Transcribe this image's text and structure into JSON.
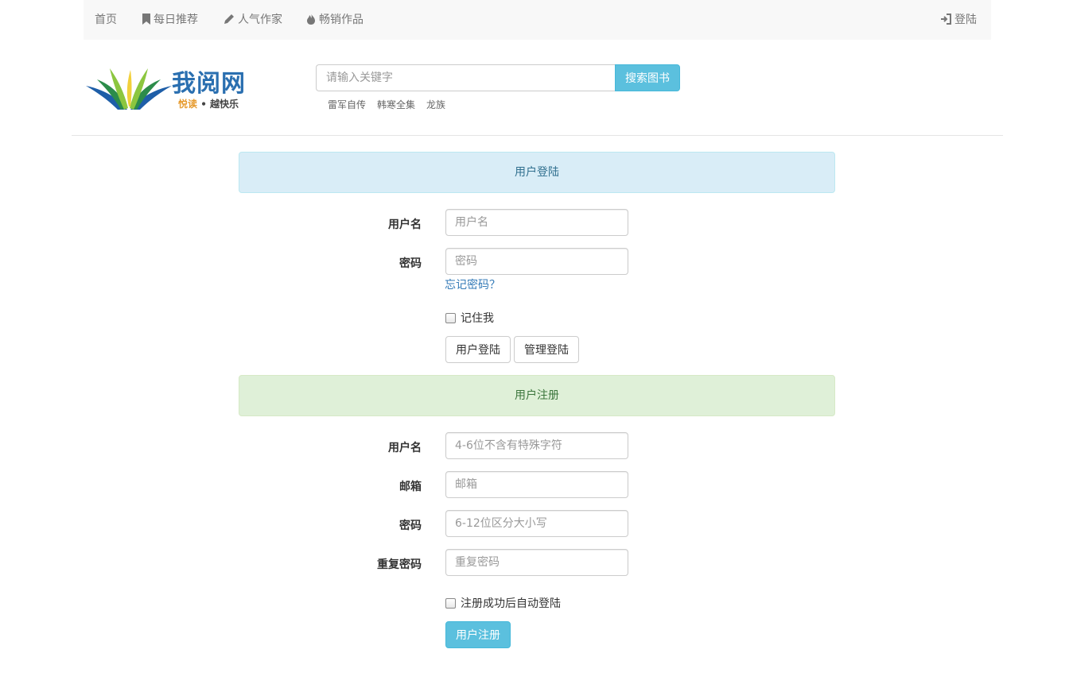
{
  "nav": {
    "home": "首页",
    "daily": "每日推荐",
    "authors": "人气作家",
    "bestsellers": "畅销作品",
    "login": "登陆"
  },
  "logo": {
    "title": "我阅网",
    "slogan_a": "悦读",
    "slogan_sep": " • ",
    "slogan_b": "越快乐"
  },
  "search": {
    "placeholder": "请输入关键字",
    "button": "搜索图书",
    "hotwords": [
      "雷军自传",
      "韩寒全集",
      "龙族"
    ]
  },
  "login": {
    "panel_title": "用户登陆",
    "username_label": "用户名",
    "username_placeholder": "用户名",
    "password_label": "密码",
    "password_placeholder": "密码",
    "forgot": "忘记密码？",
    "remember": "记住我",
    "user_login_button": "用户登陆",
    "admin_login_button": "管理登陆"
  },
  "register": {
    "panel_title": "用户注册",
    "username_label": "用户名",
    "username_placeholder": "4-6位不含有特殊字符",
    "email_label": "邮箱",
    "email_placeholder": "邮箱",
    "password_label": "密码",
    "password_placeholder": "6-12位区分大小写",
    "repeat_label": "重复密码",
    "repeat_placeholder": "重复密码",
    "auto_login": "注册成功后自动登陆",
    "register_button": "用户注册"
  },
  "colors": {
    "accent": "#5bc0de",
    "link": "#337ab7",
    "info_bg": "#d9edf7",
    "success_bg": "#dff0d8"
  }
}
